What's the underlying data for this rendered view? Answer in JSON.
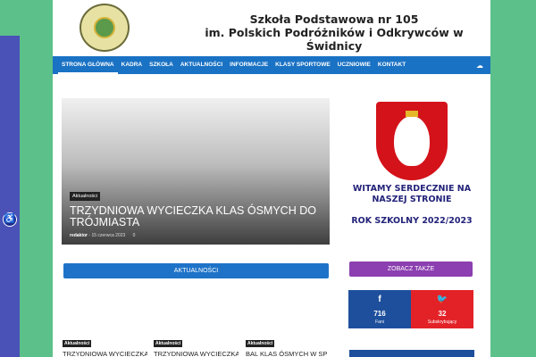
{
  "header": {
    "school_line1": "Szkoła Podstawowa nr 105",
    "school_line2": "im. Polskich Podróżników i Odkrywców  w Świdnicy"
  },
  "nav": {
    "items": [
      "STRONA GŁÓWNA",
      "KADRA",
      "SZKOŁA",
      "AKTUALNOŚCI",
      "INFORMACJE",
      "KLASY SPORTOWE",
      "UCZNIOWIE",
      "KONTAKT"
    ],
    "search_icon": "cloud-icon"
  },
  "hero": {
    "tag": "Aktualności",
    "title": "TRZYDNIOWA WYCIECZKA KLAS ÓSMYCH DO TRÓJMIASTA",
    "author": "redaktor",
    "separator": "-",
    "date": "15 czerwca 2023",
    "comments": "0"
  },
  "sidebar": {
    "welcome": "WITAMY SERDECZNIE NA NASZEJ STRONIE",
    "year": "ROK SZKOLNY 2022/2023",
    "section_title": "ZOBACZ TAKŻE",
    "facebook": {
      "icon": "f",
      "count": "716",
      "label": "Fani"
    },
    "twitter": {
      "icon": "🐦",
      "count": "32",
      "label": "Subskrybujący"
    }
  },
  "news": {
    "section_title": "AKTUALNOŚCI",
    "cards": [
      {
        "tag": "Aktualności",
        "title": "TRZYDNIOWA WYCIECZKA"
      },
      {
        "tag": "Aktualności",
        "title": "TRZYDNIOWA WYCIECZKA"
      },
      {
        "tag": "Aktualności",
        "title": "BAL KLAS ÓSMYCH W SP"
      }
    ]
  },
  "colors": {
    "nav": "#1a72c4",
    "background": "#5cc08a",
    "facebook": "#1e4f9c",
    "twitter": "#e32228",
    "zobacz": "#8b3fb0"
  }
}
